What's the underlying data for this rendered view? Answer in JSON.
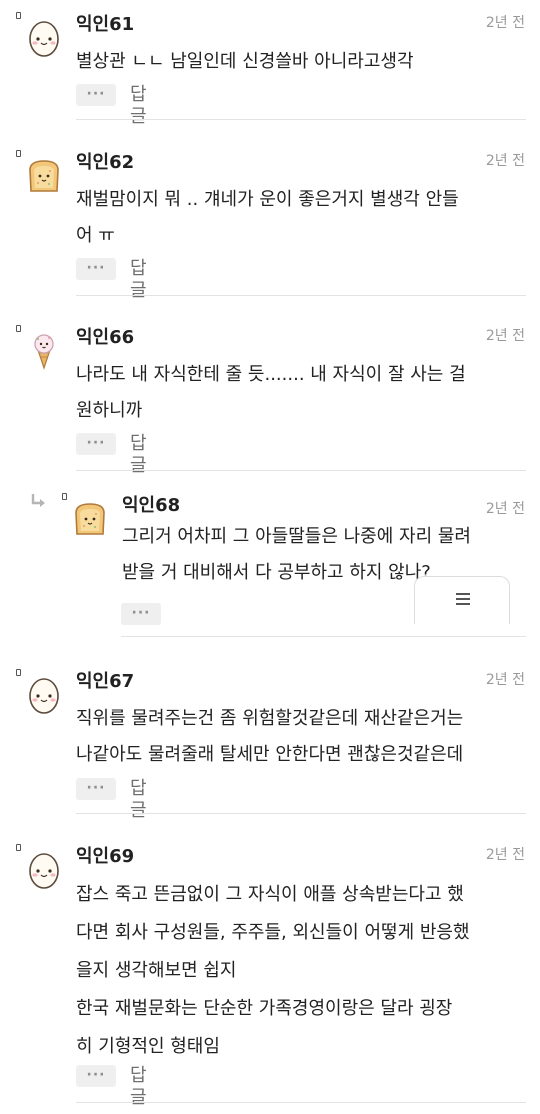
{
  "comments": [
    {
      "author": "익인61",
      "time": "2년 전",
      "lines": [
        "별상관 ㄴㄴ 남일인데 신경쓸바 아니라고생각"
      ],
      "more_label": "···",
      "reply_label": "답글",
      "avatar": "egg-icon"
    },
    {
      "author": "익인62",
      "time": "2년 전",
      "lines": [
        "재벌맘이지 뭐 .. 걔네가 운이 좋은거지 별생각 안들",
        "어 ㅠ"
      ],
      "more_label": "···",
      "reply_label": "답글",
      "avatar": "toast-icon"
    },
    {
      "author": "익인66",
      "time": "2년 전",
      "lines": [
        "나라도 내 자식한테 줄 듯....... 내 자식이 잘 사는 걸",
        "원하니까"
      ],
      "more_label": "···",
      "reply_label": "답글",
      "avatar": "ice-cream-icon"
    },
    {
      "author": "익인68",
      "time": "2년 전",
      "lines": [
        "그리거 어차피 그 아들딸들은 나중에 자리 물려",
        "받을 거 대비해서 다 공부하고 하지 않나?"
      ],
      "more_label": "···",
      "avatar": "toast-icon",
      "is_reply": true
    },
    {
      "author": "익인67",
      "time": "2년 전",
      "lines": [
        "직위를 물려주는건 좀 위험할것같은데 재산같은거는",
        "나같아도 물려줄래 탈세만 안한다면 괜찮은것같은데"
      ],
      "more_label": "···",
      "reply_label": "답글",
      "avatar": "egg-icon"
    },
    {
      "author": "익인69",
      "time": "2년 전",
      "lines": [
        "잡스 죽고 뜬금없이 그 자식이 애플 상속받는다고 했",
        "다면 회사 구성원들, 주주들, 외신들이 어떻게 반응했",
        "을지 생각해보면 쉽지",
        "한국 재벌문화는 단순한 가족경영이랑은 달라 굉장",
        "히 기형적인 형태임"
      ],
      "more_label": "···",
      "reply_label": "답글",
      "avatar": "egg-icon"
    }
  ],
  "menu_button": {
    "icon": "menu-icon"
  },
  "colors": {
    "time": "#9a9a9a",
    "reply_text": "#6f6f6f",
    "divider": "#e3e3e3",
    "more_bg": "#efefef"
  }
}
